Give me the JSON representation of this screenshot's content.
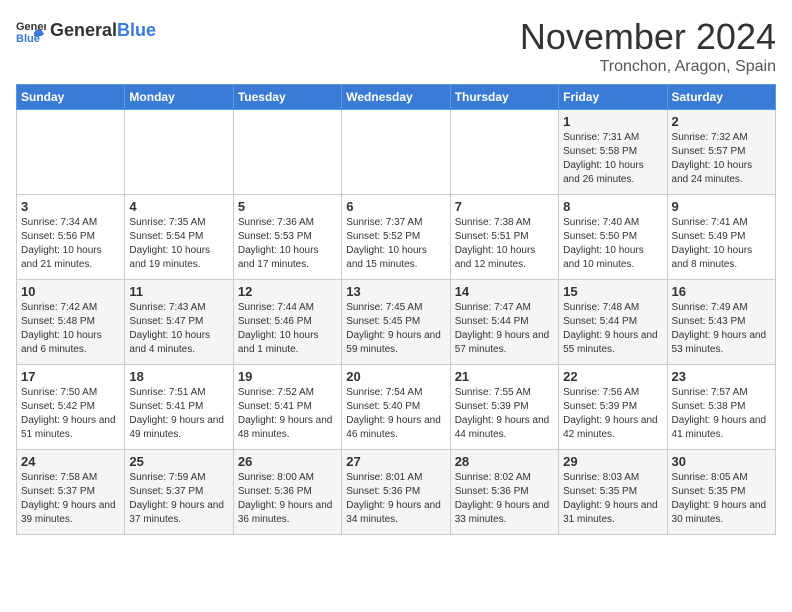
{
  "header": {
    "logo_general": "General",
    "logo_blue": "Blue",
    "month": "November 2024",
    "location": "Tronchon, Aragon, Spain"
  },
  "weekdays": [
    "Sunday",
    "Monday",
    "Tuesday",
    "Wednesday",
    "Thursday",
    "Friday",
    "Saturday"
  ],
  "weeks": [
    [
      {
        "day": "",
        "info": ""
      },
      {
        "day": "",
        "info": ""
      },
      {
        "day": "",
        "info": ""
      },
      {
        "day": "",
        "info": ""
      },
      {
        "day": "",
        "info": ""
      },
      {
        "day": "1",
        "info": "Sunrise: 7:31 AM\nSunset: 5:58 PM\nDaylight: 10 hours and 26 minutes."
      },
      {
        "day": "2",
        "info": "Sunrise: 7:32 AM\nSunset: 5:57 PM\nDaylight: 10 hours and 24 minutes."
      }
    ],
    [
      {
        "day": "3",
        "info": "Sunrise: 7:34 AM\nSunset: 5:56 PM\nDaylight: 10 hours and 21 minutes."
      },
      {
        "day": "4",
        "info": "Sunrise: 7:35 AM\nSunset: 5:54 PM\nDaylight: 10 hours and 19 minutes."
      },
      {
        "day": "5",
        "info": "Sunrise: 7:36 AM\nSunset: 5:53 PM\nDaylight: 10 hours and 17 minutes."
      },
      {
        "day": "6",
        "info": "Sunrise: 7:37 AM\nSunset: 5:52 PM\nDaylight: 10 hours and 15 minutes."
      },
      {
        "day": "7",
        "info": "Sunrise: 7:38 AM\nSunset: 5:51 PM\nDaylight: 10 hours and 12 minutes."
      },
      {
        "day": "8",
        "info": "Sunrise: 7:40 AM\nSunset: 5:50 PM\nDaylight: 10 hours and 10 minutes."
      },
      {
        "day": "9",
        "info": "Sunrise: 7:41 AM\nSunset: 5:49 PM\nDaylight: 10 hours and 8 minutes."
      }
    ],
    [
      {
        "day": "10",
        "info": "Sunrise: 7:42 AM\nSunset: 5:48 PM\nDaylight: 10 hours and 6 minutes."
      },
      {
        "day": "11",
        "info": "Sunrise: 7:43 AM\nSunset: 5:47 PM\nDaylight: 10 hours and 4 minutes."
      },
      {
        "day": "12",
        "info": "Sunrise: 7:44 AM\nSunset: 5:46 PM\nDaylight: 10 hours and 1 minute."
      },
      {
        "day": "13",
        "info": "Sunrise: 7:45 AM\nSunset: 5:45 PM\nDaylight: 9 hours and 59 minutes."
      },
      {
        "day": "14",
        "info": "Sunrise: 7:47 AM\nSunset: 5:44 PM\nDaylight: 9 hours and 57 minutes."
      },
      {
        "day": "15",
        "info": "Sunrise: 7:48 AM\nSunset: 5:44 PM\nDaylight: 9 hours and 55 minutes."
      },
      {
        "day": "16",
        "info": "Sunrise: 7:49 AM\nSunset: 5:43 PM\nDaylight: 9 hours and 53 minutes."
      }
    ],
    [
      {
        "day": "17",
        "info": "Sunrise: 7:50 AM\nSunset: 5:42 PM\nDaylight: 9 hours and 51 minutes."
      },
      {
        "day": "18",
        "info": "Sunrise: 7:51 AM\nSunset: 5:41 PM\nDaylight: 9 hours and 49 minutes."
      },
      {
        "day": "19",
        "info": "Sunrise: 7:52 AM\nSunset: 5:41 PM\nDaylight: 9 hours and 48 minutes."
      },
      {
        "day": "20",
        "info": "Sunrise: 7:54 AM\nSunset: 5:40 PM\nDaylight: 9 hours and 46 minutes."
      },
      {
        "day": "21",
        "info": "Sunrise: 7:55 AM\nSunset: 5:39 PM\nDaylight: 9 hours and 44 minutes."
      },
      {
        "day": "22",
        "info": "Sunrise: 7:56 AM\nSunset: 5:39 PM\nDaylight: 9 hours and 42 minutes."
      },
      {
        "day": "23",
        "info": "Sunrise: 7:57 AM\nSunset: 5:38 PM\nDaylight: 9 hours and 41 minutes."
      }
    ],
    [
      {
        "day": "24",
        "info": "Sunrise: 7:58 AM\nSunset: 5:37 PM\nDaylight: 9 hours and 39 minutes."
      },
      {
        "day": "25",
        "info": "Sunrise: 7:59 AM\nSunset: 5:37 PM\nDaylight: 9 hours and 37 minutes."
      },
      {
        "day": "26",
        "info": "Sunrise: 8:00 AM\nSunset: 5:36 PM\nDaylight: 9 hours and 36 minutes."
      },
      {
        "day": "27",
        "info": "Sunrise: 8:01 AM\nSunset: 5:36 PM\nDaylight: 9 hours and 34 minutes."
      },
      {
        "day": "28",
        "info": "Sunrise: 8:02 AM\nSunset: 5:36 PM\nDaylight: 9 hours and 33 minutes."
      },
      {
        "day": "29",
        "info": "Sunrise: 8:03 AM\nSunset: 5:35 PM\nDaylight: 9 hours and 31 minutes."
      },
      {
        "day": "30",
        "info": "Sunrise: 8:05 AM\nSunset: 5:35 PM\nDaylight: 9 hours and 30 minutes."
      }
    ]
  ]
}
